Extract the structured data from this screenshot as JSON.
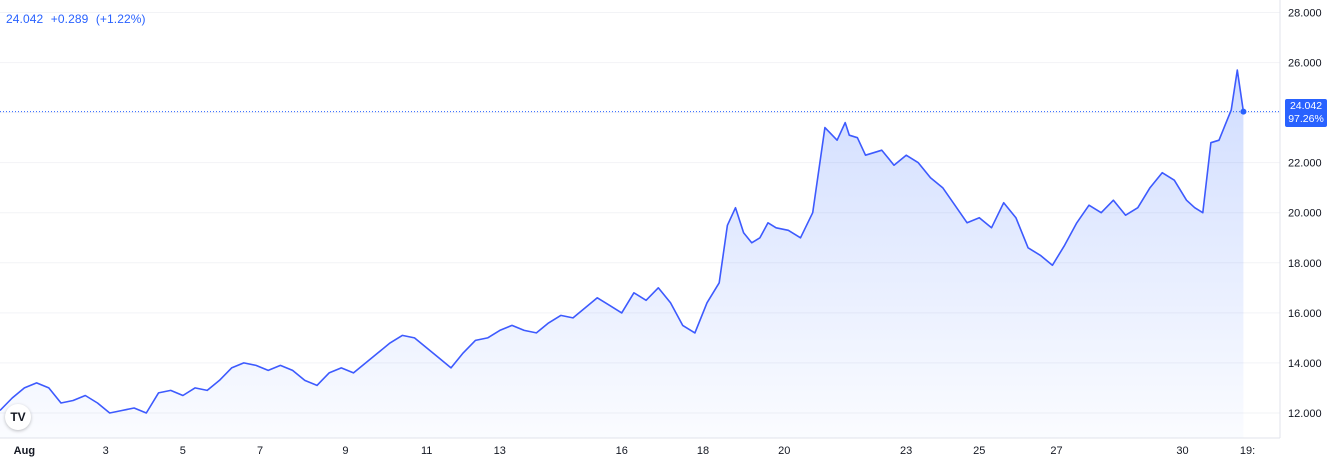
{
  "legend": {
    "last": "24.042",
    "change": "+0.289",
    "change_pct": "(+1.22%)"
  },
  "price_badge": {
    "price": "24.042",
    "percent": "97.26%"
  },
  "logo": {
    "text": "TV"
  },
  "colors": {
    "line": "#3d5afe",
    "accent": "#2962ff",
    "grid": "#e0e3eb",
    "axis_text": "#131722"
  },
  "chart_data": {
    "type": "area",
    "title": "",
    "xlabel": "",
    "ylabel": "",
    "ylim": [
      11.0,
      28.5
    ],
    "y_ticks": [
      "12.000",
      "14.000",
      "16.000",
      "18.000",
      "20.000",
      "22.000",
      "24.000",
      "26.000",
      "28.000"
    ],
    "x_ticks": [
      {
        "label": "Aug",
        "x": 0.6,
        "bold": true
      },
      {
        "label": "3",
        "x": 2.6
      },
      {
        "label": "5",
        "x": 4.5
      },
      {
        "label": "7",
        "x": 6.4
      },
      {
        "label": "9",
        "x": 8.5
      },
      {
        "label": "11",
        "x": 10.5
      },
      {
        "label": "13",
        "x": 12.3
      },
      {
        "label": "16",
        "x": 15.3
      },
      {
        "label": "18",
        "x": 17.3
      },
      {
        "label": "20",
        "x": 19.3
      },
      {
        "label": "23",
        "x": 22.3
      },
      {
        "label": "25",
        "x": 24.1
      },
      {
        "label": "27",
        "x": 26.0
      },
      {
        "label": "30",
        "x": 29.1
      },
      {
        "label": "19:",
        "x": 30.7
      }
    ],
    "xlim": [
      0,
      31.5
    ],
    "last_value": 24.042,
    "series": [
      {
        "x": [
          0.0,
          0.3,
          0.6,
          0.9,
          1.2,
          1.5,
          1.8,
          2.1,
          2.4,
          2.7,
          3.0,
          3.3,
          3.6,
          3.9,
          4.2,
          4.5,
          4.8,
          5.1,
          5.4,
          5.7,
          6.0,
          6.3,
          6.6,
          6.9,
          7.2,
          7.5,
          7.8,
          8.1,
          8.4,
          8.7,
          9.0,
          9.3,
          9.6,
          9.9,
          10.2,
          10.5,
          10.8,
          11.1,
          11.4,
          11.7,
          12.0,
          12.3,
          12.6,
          12.9,
          13.2,
          13.5,
          13.8,
          14.1,
          14.4,
          14.7,
          15.0,
          15.3,
          15.6,
          15.9,
          16.2,
          16.5,
          16.8,
          17.1,
          17.4,
          17.7,
          17.9,
          18.1,
          18.3,
          18.5,
          18.7,
          18.9,
          19.1,
          19.4,
          19.7,
          20.0,
          20.3,
          20.6,
          20.8,
          20.9,
          21.1,
          21.3,
          21.5,
          21.7,
          22.0,
          22.3,
          22.6,
          22.9,
          23.2,
          23.5,
          23.8,
          24.1,
          24.4,
          24.7,
          25.0,
          25.3,
          25.6,
          25.9,
          26.2,
          26.5,
          26.8,
          27.1,
          27.4,
          27.7,
          28.0,
          28.3,
          28.6,
          28.9,
          29.2,
          29.4,
          29.6,
          29.8,
          30.0,
          30.15,
          30.3,
          30.45,
          30.6
        ],
        "values": [
          12.1,
          12.6,
          13.0,
          13.2,
          13.0,
          12.4,
          12.5,
          12.7,
          12.4,
          12.0,
          12.1,
          12.2,
          12.0,
          12.8,
          12.9,
          12.7,
          13.0,
          12.9,
          13.3,
          13.8,
          14.0,
          13.9,
          13.7,
          13.9,
          13.7,
          13.3,
          13.1,
          13.6,
          13.8,
          13.6,
          14.0,
          14.4,
          14.8,
          15.1,
          15.0,
          14.6,
          14.2,
          13.8,
          14.4,
          14.9,
          15.0,
          15.3,
          15.5,
          15.3,
          15.2,
          15.6,
          15.9,
          15.8,
          16.2,
          16.6,
          16.3,
          16.0,
          16.8,
          16.5,
          17.0,
          16.4,
          15.5,
          15.2,
          16.4,
          17.2,
          19.5,
          20.2,
          19.2,
          18.8,
          19.0,
          19.6,
          19.4,
          19.3,
          19.0,
          20.0,
          23.4,
          22.9,
          23.6,
          23.1,
          23.0,
          22.3,
          22.4,
          22.5,
          21.9,
          22.3,
          22.0,
          21.4,
          21.0,
          20.3,
          19.6,
          19.8,
          19.4,
          20.4,
          19.8,
          18.6,
          18.3,
          17.9,
          18.7,
          19.6,
          20.3,
          20.0,
          20.5,
          19.9,
          20.2,
          21.0,
          21.6,
          21.3,
          20.5,
          20.2,
          20.0,
          22.8,
          22.9,
          23.5,
          24.1,
          25.7,
          24.042
        ]
      }
    ]
  }
}
